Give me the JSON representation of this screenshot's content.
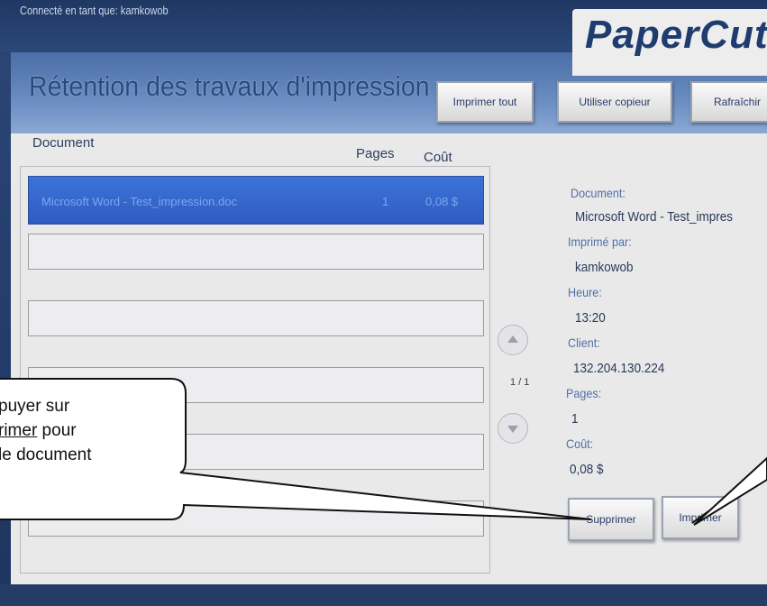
{
  "header": {
    "login_text": "Connecté en tant que: kamkowob",
    "logo": "PaperCut"
  },
  "title": "Rétention des travaux d'impression",
  "toolbar": {
    "print_all": "Imprimer tout",
    "use_copier": "Utiliser copieur",
    "refresh": "Rafraîchir"
  },
  "columns": {
    "document": "Document",
    "pages": "Pages",
    "cost": "Coût"
  },
  "jobs": [
    {
      "document": "Microsoft Word - Test_impression.doc",
      "pages": "1",
      "cost": "0,08 $",
      "selected": true
    }
  ],
  "pager": {
    "indicator": "1 / 1"
  },
  "details": {
    "document_label": "Document:",
    "document_value": "Microsoft Word - Test_impres",
    "printed_by_label": "Imprimé par:",
    "printed_by_value": "kamkowob",
    "time_label": "Heure:",
    "time_value": "13:20",
    "client_label": "Client:",
    "client_value": "132.204.130.224",
    "pages_label": "Pages:",
    "pages_value": "1",
    "cost_label": "Coût:",
    "cost_value": "0,08 $"
  },
  "actions": {
    "delete": "Supprimer",
    "print": "Imprimer"
  },
  "callout": {
    "line1": "puyer sur",
    "line2_underlined": "rimer",
    "line2_rest": " pour",
    "line3": "le document"
  },
  "colors": {
    "accent": "#3d73d8",
    "title_band": "#6a8dc2",
    "panel": "#e9e9ea"
  }
}
